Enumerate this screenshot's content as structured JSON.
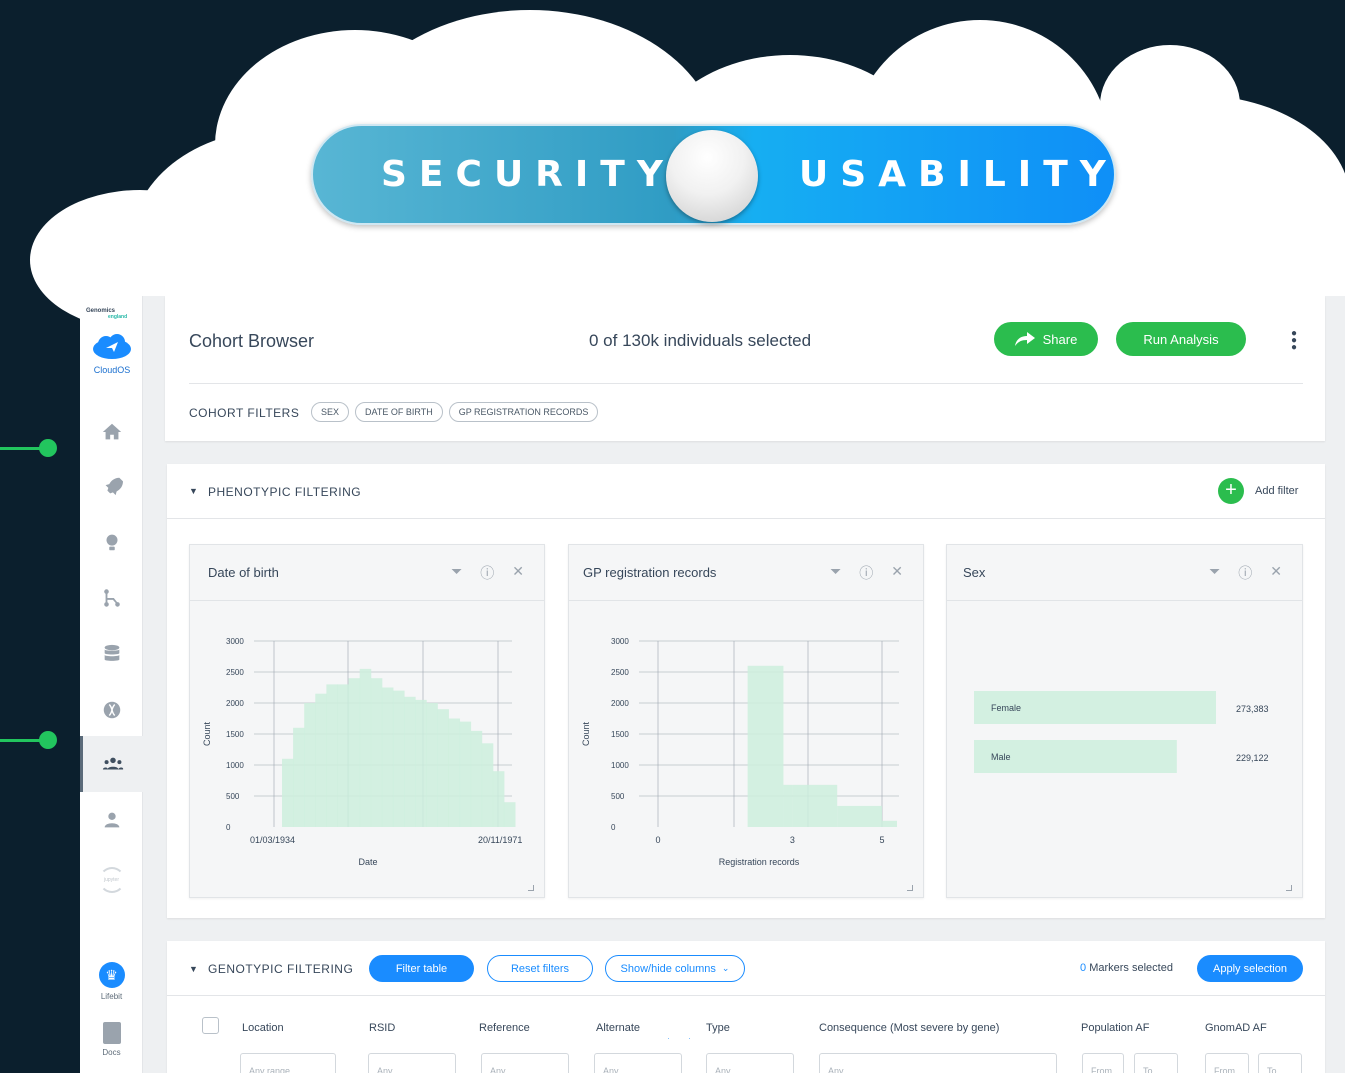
{
  "banner": {
    "left": "SECURITY",
    "right": "USABILITY"
  },
  "logo": {
    "line1": "Genomics",
    "line2": "england",
    "name": "CloudOS"
  },
  "sidebar": {
    "bottom": [
      {
        "label": "Lifebit"
      },
      {
        "label": "Docs"
      }
    ],
    "jupyter": "jupyter"
  },
  "header": {
    "title": "Cohort Browser",
    "selection": "0 of 130k individuals selected",
    "share": "Share",
    "run": "Run Analysis",
    "filters_label": "COHORT FILTERS",
    "filters": [
      "SEX",
      "DATE OF BIRTH",
      "GP REGISTRATION RECORDS"
    ]
  },
  "pheno": {
    "title": "PHENOTYPIC FILTERING",
    "add": "Add filter"
  },
  "cards": [
    {
      "title": "Date of birth"
    },
    {
      "title": "GP registration records"
    },
    {
      "title": "Sex"
    }
  ],
  "chart_data": [
    {
      "type": "bar",
      "title": "Date of birth",
      "xlabel": "Date",
      "ylabel": "Count",
      "ylim": [
        0,
        3000
      ],
      "yticks": [
        "3000",
        "2500",
        "2000",
        "1500",
        "1000",
        "500",
        "0"
      ],
      "xticklabels": [
        "01/03/1934",
        "20/11/1971"
      ],
      "values": [
        1100,
        1600,
        2000,
        2150,
        2300,
        2300,
        2400,
        2550,
        2400,
        2250,
        2200,
        2100,
        2050,
        2000,
        1900,
        1750,
        1700,
        1550,
        1350,
        900,
        400
      ]
    },
    {
      "type": "bar",
      "title": "GP registration records",
      "xlabel": "Registration records",
      "ylabel": "Count",
      "ylim": [
        0,
        3000
      ],
      "yticks": [
        "3000",
        "2500",
        "2000",
        "1500",
        "1000",
        "500",
        "0"
      ],
      "xticks": [
        "0",
        "3",
        "5"
      ],
      "bars": [
        {
          "x0": 2,
          "x1": 2.8,
          "value": 2600
        },
        {
          "x0": 2.8,
          "x1": 3,
          "value": 680
        },
        {
          "x0": 3,
          "x1": 4,
          "value": 680
        },
        {
          "x0": 4,
          "x1": 5,
          "value": 340
        },
        {
          "x0": 5,
          "x1": 5.8,
          "value": 100
        }
      ]
    },
    {
      "type": "bar",
      "title": "Sex",
      "categories": [
        "Female",
        "Male"
      ],
      "values": [
        273383,
        229122
      ],
      "labels": [
        "273,383",
        "229,122"
      ]
    }
  ],
  "geno": {
    "title": "GENOTYPIC FILTERING",
    "filter_table": "Filter table",
    "reset": "Reset filters",
    "show_hide": "Show/hide columns",
    "markers_count": "0",
    "markers_text": "Markers selected",
    "apply": "Apply selection",
    "columns": [
      "Location",
      "RSID",
      "Reference",
      "Alternate",
      "Type",
      "Consequence (Most severe by gene)",
      "Population AF",
      "GnomAD AF"
    ],
    "placeholders": [
      "Any range",
      "Any",
      "Any",
      "Any",
      "Any",
      "Any",
      "From",
      "To",
      "From",
      "To"
    ]
  },
  "colors": {
    "accent_green": "#2bbd4e",
    "accent_blue": "#1a8cff",
    "bar_fill": "#cdeedd",
    "bg_dark": "#0b1f2d"
  }
}
